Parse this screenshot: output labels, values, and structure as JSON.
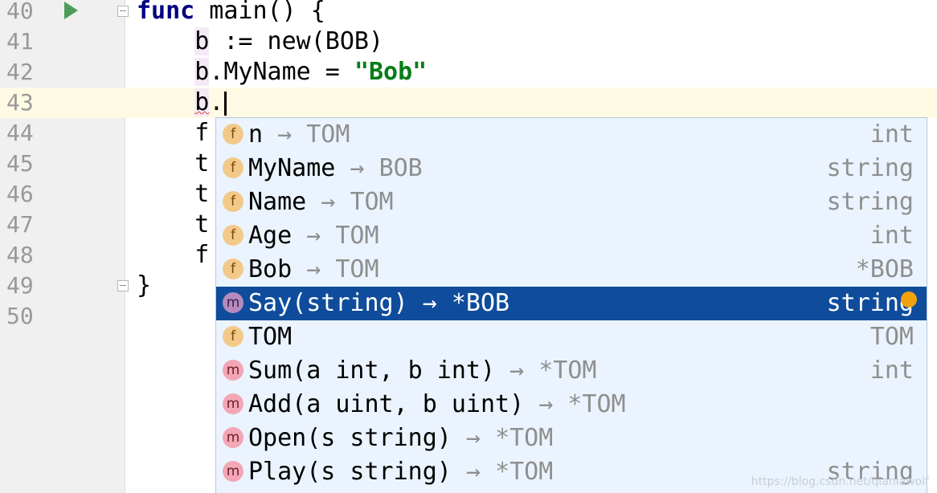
{
  "editor": {
    "lines": [
      {
        "num": "40",
        "parts": [
          {
            "t": "func",
            "c": "kw"
          },
          {
            "t": " main() {",
            "c": ""
          }
        ]
      },
      {
        "num": "41",
        "parts": [
          {
            "t": "    ",
            "c": ""
          },
          {
            "t": "b",
            "c": "var"
          },
          {
            "t": " := new(BOB)",
            "c": ""
          }
        ]
      },
      {
        "num": "42",
        "parts": [
          {
            "t": "    ",
            "c": ""
          },
          {
            "t": "b",
            "c": "var"
          },
          {
            "t": ".MyName = ",
            "c": ""
          },
          {
            "t": "\"Bob\"",
            "c": "str"
          }
        ]
      },
      {
        "num": "43",
        "parts": [
          {
            "t": "    ",
            "c": ""
          },
          {
            "t": "b",
            "c": "var-err"
          },
          {
            "t": ".",
            "c": ""
          }
        ]
      },
      {
        "num": "44",
        "parts": [
          {
            "t": "    f",
            "c": ""
          }
        ]
      },
      {
        "num": "45",
        "parts": [
          {
            "t": "    t",
            "c": ""
          }
        ]
      },
      {
        "num": "46",
        "parts": [
          {
            "t": "    t",
            "c": ""
          }
        ]
      },
      {
        "num": "47",
        "parts": [
          {
            "t": "    t",
            "c": ""
          }
        ]
      },
      {
        "num": "48",
        "parts": [
          {
            "t": "    f",
            "c": ""
          }
        ]
      },
      {
        "num": "49",
        "parts": [
          {
            "t": "}",
            "c": ""
          }
        ]
      },
      {
        "num": "50",
        "parts": []
      }
    ]
  },
  "completion": {
    "items": [
      {
        "kind": "f",
        "name": "n",
        "arrow": " → ",
        "recv": "TOM",
        "type": "int"
      },
      {
        "kind": "f",
        "name": "MyName",
        "arrow": " → ",
        "recv": "BOB",
        "type": "string"
      },
      {
        "kind": "f",
        "name": "Name",
        "arrow": " → ",
        "recv": "TOM",
        "type": "string"
      },
      {
        "kind": "f",
        "name": "Age",
        "arrow": " → ",
        "recv": "TOM",
        "type": "int"
      },
      {
        "kind": "f",
        "name": "Bob",
        "arrow": " → ",
        "recv": "TOM",
        "type": "*BOB"
      },
      {
        "kind": "m",
        "name": "Say(string)",
        "arrow": " → ",
        "recv": "*BOB",
        "type": "string",
        "selected": true
      },
      {
        "kind": "f",
        "name": "TOM",
        "arrow": "",
        "recv": "",
        "type": "TOM"
      },
      {
        "kind": "m",
        "name": "Sum(a int, b int)",
        "arrow": " → ",
        "recv": "*TOM",
        "type": "int"
      },
      {
        "kind": "m",
        "name": "Add(a uint, b uint)",
        "arrow": " → ",
        "recv": "*TOM",
        "type": ""
      },
      {
        "kind": "m",
        "name": "Open(s string)",
        "arrow": " → ",
        "recv": "*TOM",
        "type": ""
      },
      {
        "kind": "m",
        "name": "Play(s string)",
        "arrow": " → ",
        "recv": "*TOM",
        "type": "string"
      }
    ]
  },
  "watermark": "https://blog.csdn.net/qianlawolf"
}
